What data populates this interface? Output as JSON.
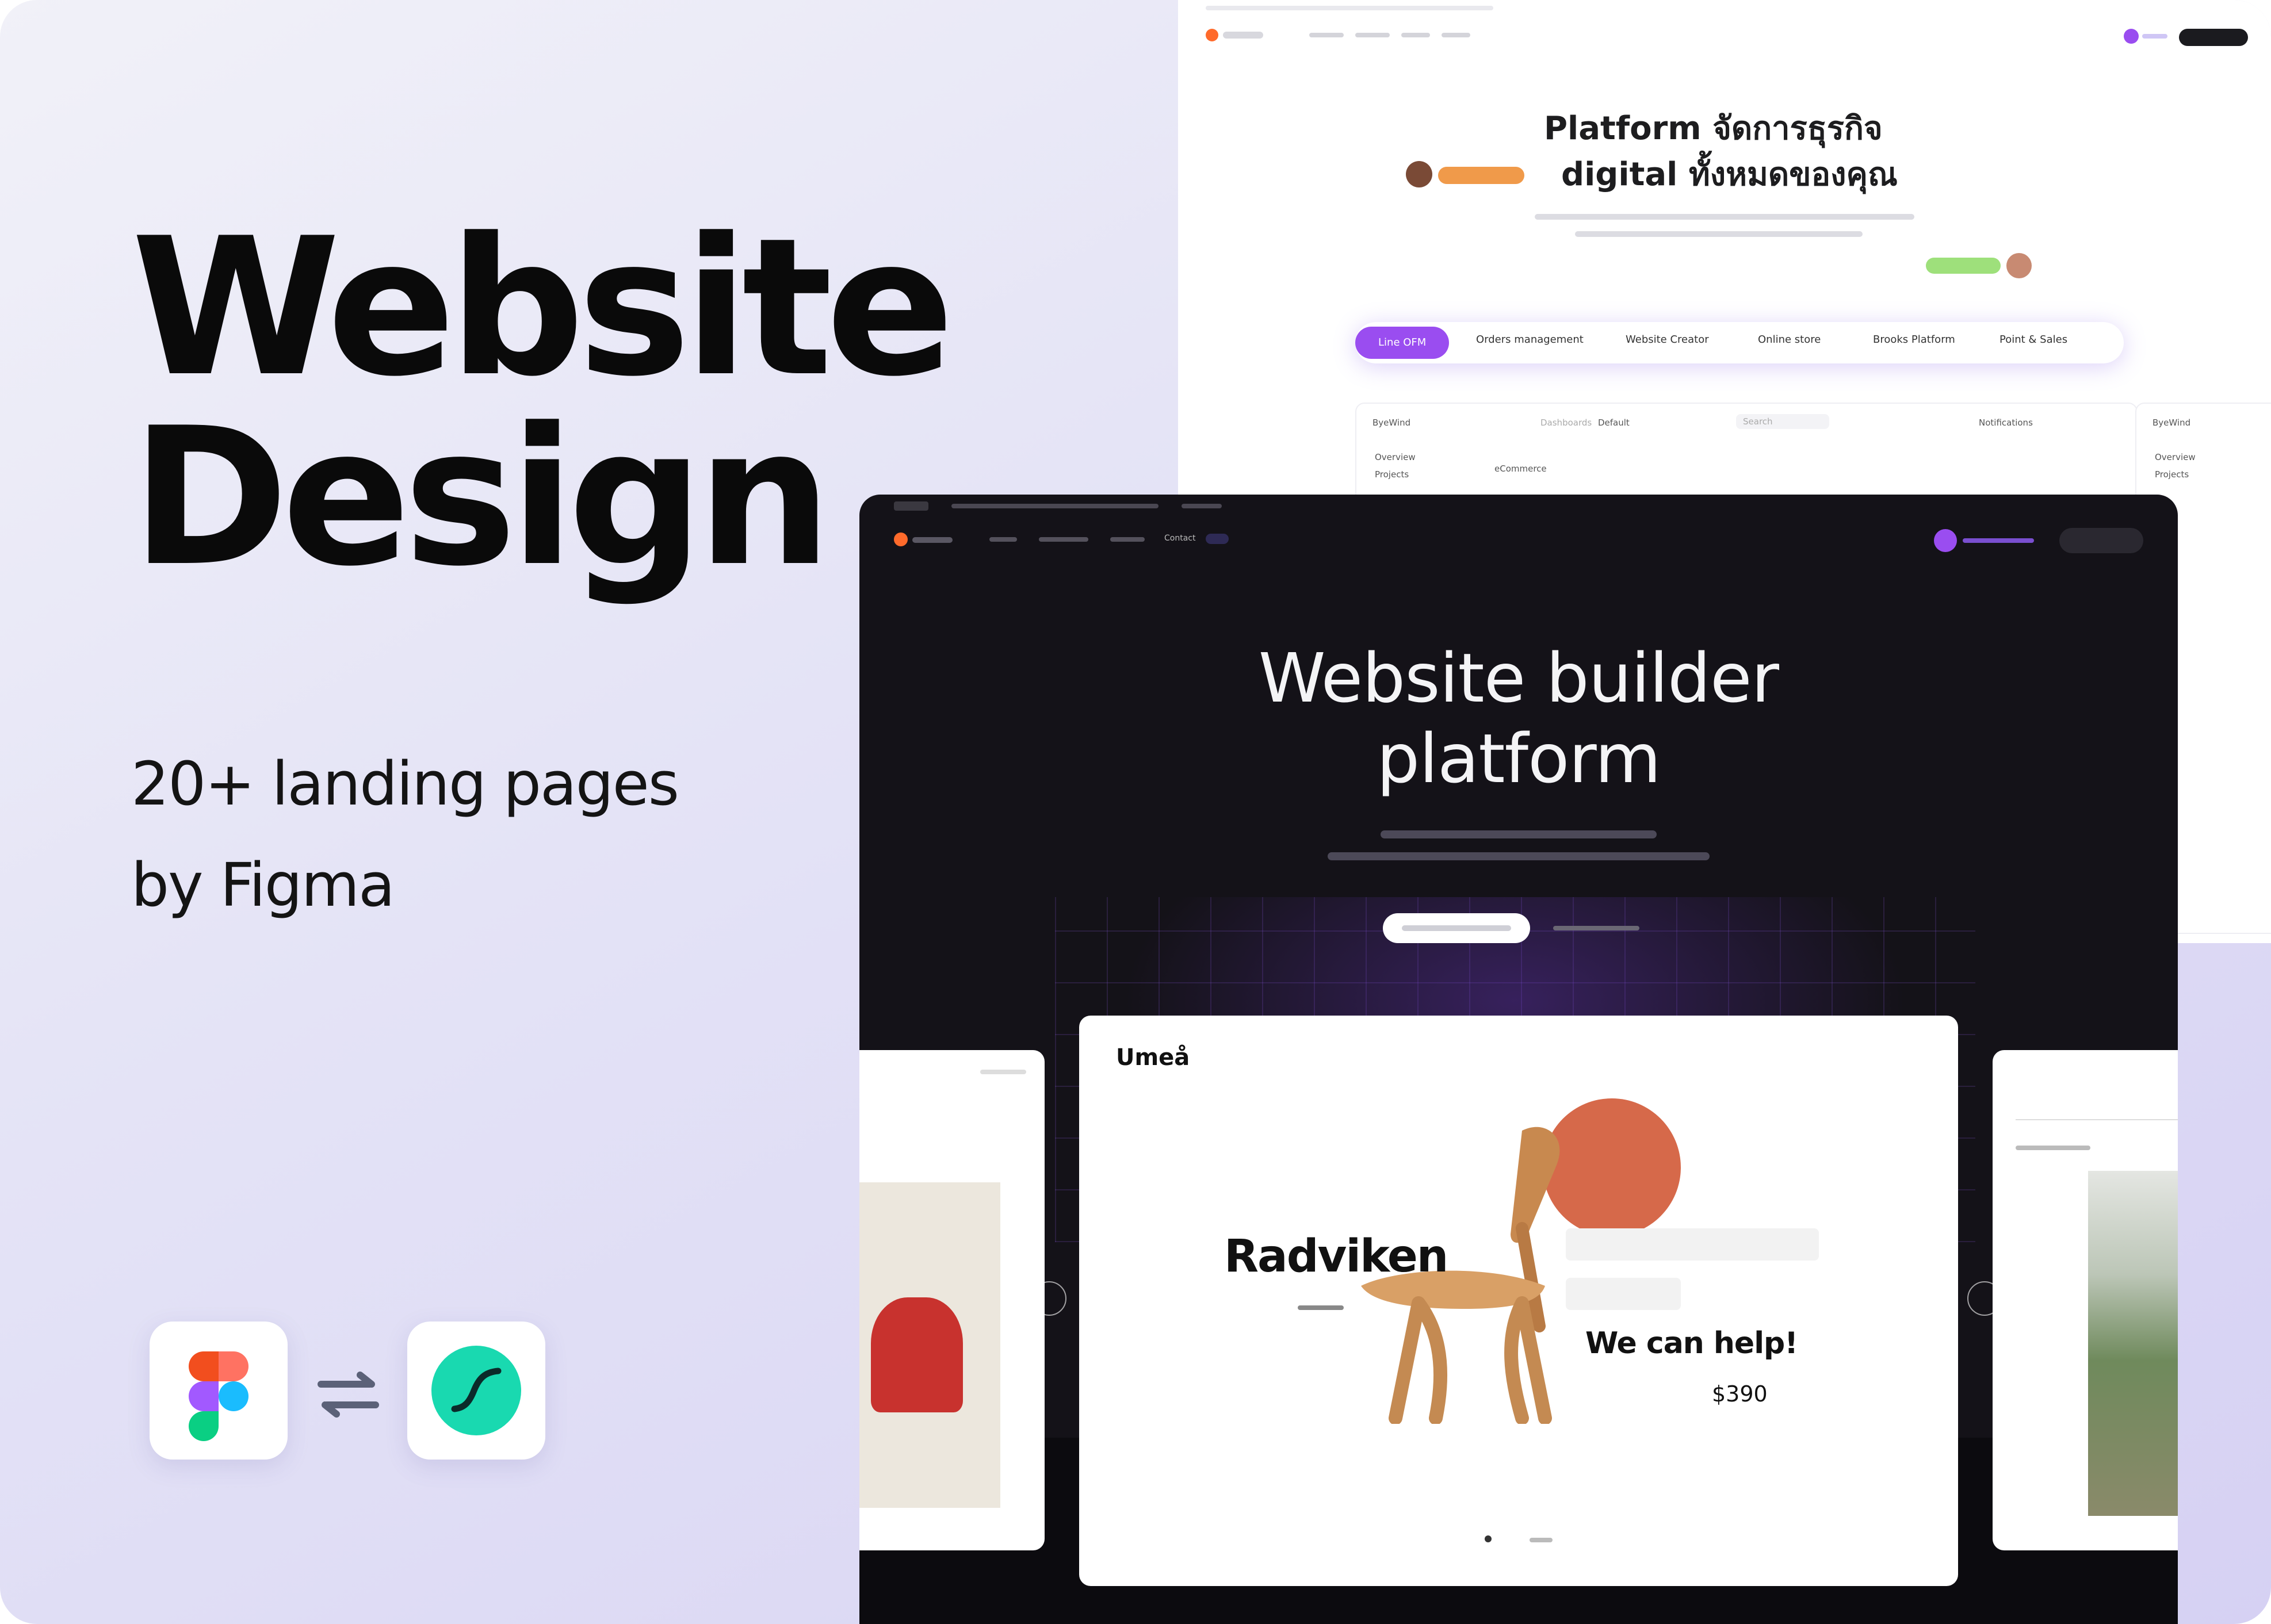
{
  "headline": {
    "line1": "Website",
    "line2": "Design"
  },
  "subtitle": {
    "line1": "20+ landing pages",
    "line2": "by Figma"
  },
  "tools": {
    "left_icon": "figma-logo",
    "swap_icon": "swap-arrows-icon",
    "right_icon": "anima-logo"
  },
  "colors": {
    "accent_purple": "#9a4df0",
    "dark_bg": "#141218",
    "product_sun": "#d6694a",
    "bg_lavender": "#d6d1f3"
  },
  "light_page": {
    "hero_line1": "Platform จัดการธุรกิจ",
    "hero_line2": "digital ทั้งหมดของคุณ",
    "tabs": [
      {
        "label": "Line OFM",
        "active": true
      },
      {
        "label": "Orders management",
        "active": false
      },
      {
        "label": "Website Creator",
        "active": false
      },
      {
        "label": "Online store",
        "active": false
      },
      {
        "label": "Brooks Platform",
        "active": false
      },
      {
        "label": "Point & Sales",
        "active": false
      }
    ],
    "dashboard": {
      "brand": "ByeWind",
      "breadcrumb_1": "Dashboards",
      "breadcrumb_2": "Default",
      "search_placeholder": "Search",
      "section": "eCommerce",
      "notifications": "Notifications",
      "sidebar_items": [
        "Overview",
        "Projects"
      ]
    }
  },
  "dark_page": {
    "hero_line1": "Website builder",
    "hero_line2": "platform",
    "nav_contact": "Contact"
  },
  "product_card": {
    "brand": "Umeå",
    "product_name": "Radviken",
    "tagline": "We can help!",
    "price": "$390"
  }
}
